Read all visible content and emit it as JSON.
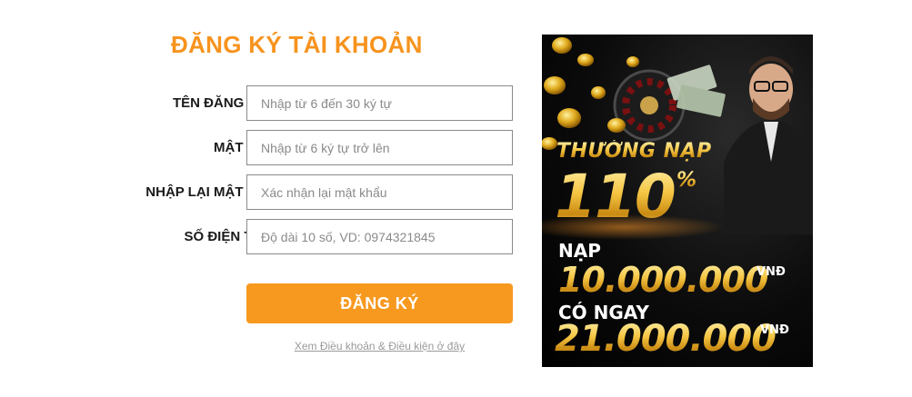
{
  "form": {
    "title": "ĐĂNG KÝ TÀI KHOẢN",
    "fields": [
      {
        "label": "TÊN ĐĂNG NHẬP",
        "placeholder": "Nhập từ 6 đến 30 ký tự",
        "value": ""
      },
      {
        "label": "MẬT KHẨU",
        "placeholder": "Nhập từ 6 ký tự trở lên",
        "value": ""
      },
      {
        "label": "NHẬP LẠI MẬT KHẨU",
        "placeholder": "Xác nhận lại mật khẩu",
        "value": ""
      },
      {
        "label": "SỐ ĐIỆN THOẠI",
        "placeholder": "Độ dài 10 số, VD: 0974321845",
        "value": ""
      }
    ],
    "submit_label": "ĐĂNG KÝ",
    "terms_link": "Xem Điều khoản & Điều kiện ở đây"
  },
  "banner": {
    "headline": "THƯỞNG NẠP",
    "percent": "110",
    "percent_sign": "%",
    "deposit_label": "NẠP",
    "deposit_amount": "10.000.000",
    "currency": "VNĐ",
    "receive_label": "CÓ NGAY",
    "receive_amount": "21.000.000"
  },
  "colors": {
    "accent": "#f7931e",
    "button": "#f7991f",
    "banner_bg": "#0b0b0b",
    "gold": "#f5c542"
  }
}
